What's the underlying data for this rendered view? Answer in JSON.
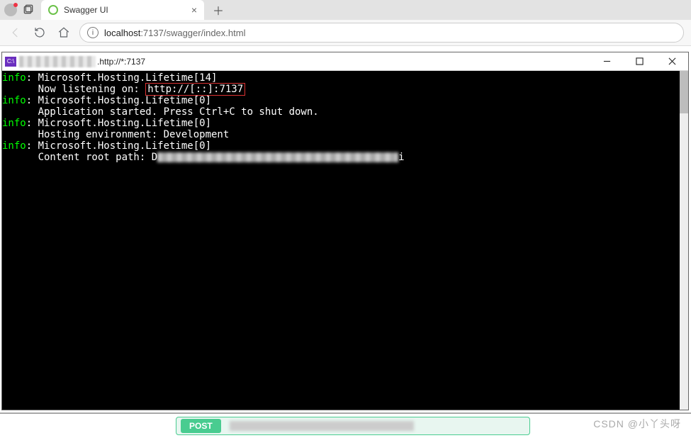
{
  "tab": {
    "title": "Swagger UI"
  },
  "url": {
    "host": "localhost",
    "rest": ":7137/swagger/index.html"
  },
  "console_window": {
    "title": ".http://*:7137"
  },
  "console_lines": [
    {
      "prefix": "info",
      "text": ": Microsoft.Hosting.Lifetime[14]"
    },
    {
      "prefix": "",
      "text": "      Now listening on: ",
      "highlight": "http://[::]:7137"
    },
    {
      "prefix": "info",
      "text": ": Microsoft.Hosting.Lifetime[0]"
    },
    {
      "prefix": "",
      "text": "      Application started. Press Ctrl+C to shut down."
    },
    {
      "prefix": "info",
      "text": ": Microsoft.Hosting.Lifetime[0]"
    },
    {
      "prefix": "",
      "text": "      Hosting environment: Development"
    },
    {
      "prefix": "info",
      "text": ": Microsoft.Hosting.Lifetime[0]"
    },
    {
      "prefix": "",
      "text": "      Content root path: D",
      "blur_tail": "i"
    }
  ],
  "swagger": {
    "method": "POST"
  },
  "watermark": "CSDN @小丫头呀"
}
